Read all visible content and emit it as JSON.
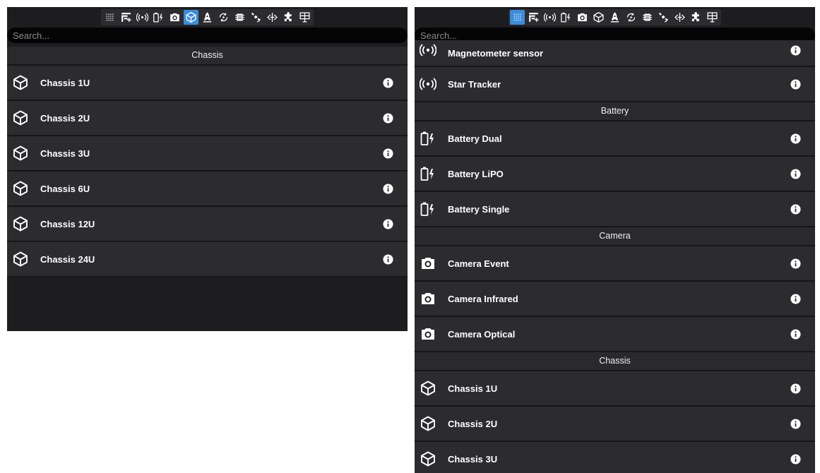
{
  "colors": {
    "panel_bg": "#1d1d1f",
    "row_bg": "#2c2c2f",
    "accent": "#3a8dde",
    "text": "#ffffff"
  },
  "toolbar": {
    "buttons": [
      {
        "icon": "grid-icon"
      },
      {
        "icon": "dashboard-add-icon"
      },
      {
        "icon": "antenna-icon"
      },
      {
        "icon": "battery-charging-icon"
      },
      {
        "icon": "camera-icon"
      },
      {
        "icon": "cube-icon"
      },
      {
        "icon": "rocket-icon"
      },
      {
        "icon": "rotation-icon"
      },
      {
        "icon": "chip-icon"
      },
      {
        "icon": "satellite-icon"
      },
      {
        "icon": "thruster-icon"
      },
      {
        "icon": "puzzle-icon"
      },
      {
        "icon": "table-icon"
      }
    ]
  },
  "left_panel": {
    "active_tool": "cube-icon",
    "search": {
      "placeholder": "Search...",
      "value": ""
    },
    "sections": [
      {
        "title": "Chassis",
        "icon": "cube-icon",
        "items": [
          "Chassis 1U",
          "Chassis 2U",
          "Chassis 3U",
          "Chassis 6U",
          "Chassis 12U",
          "Chassis 24U"
        ]
      }
    ]
  },
  "right_panel": {
    "active_tool": "grid-icon",
    "search": {
      "placeholder": "Search...",
      "value": ""
    },
    "partial_item": {
      "label": "Magnetometer sensor",
      "icon": "antenna-icon"
    },
    "items_before_sections": [
      {
        "label": "Star Tracker",
        "icon": "antenna-icon"
      }
    ],
    "sections": [
      {
        "title": "Battery",
        "icon": "battery-charging-icon",
        "items": [
          "Battery Dual",
          "Battery LiPO",
          "Battery Single"
        ]
      },
      {
        "title": "Camera",
        "icon": "camera-icon",
        "items": [
          "Camera Event",
          "Camera Infrared",
          "Camera Optical"
        ]
      },
      {
        "title": "Chassis",
        "icon": "cube-icon",
        "items": [
          "Chassis 1U",
          "Chassis 2U",
          "Chassis 3U"
        ]
      }
    ]
  }
}
